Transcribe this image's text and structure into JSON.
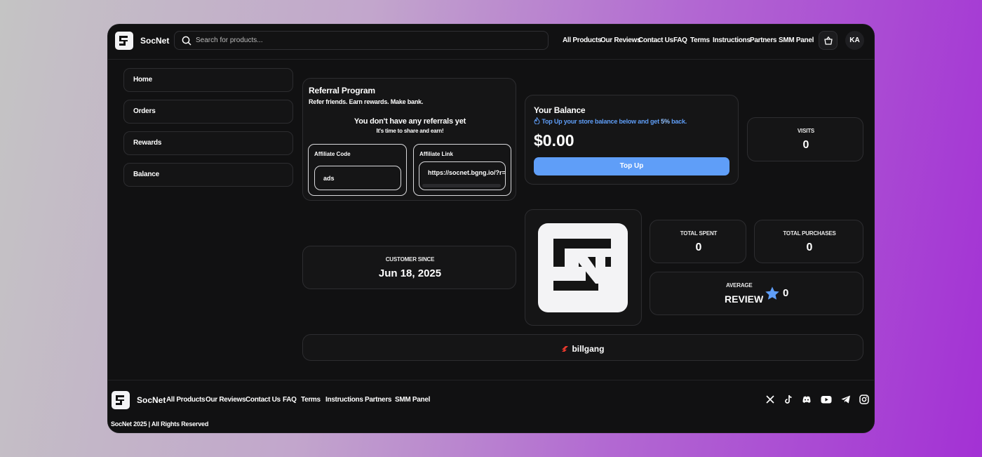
{
  "header": {
    "brand": "SocNet",
    "search_placeholder": "Search for products...",
    "nav": [
      "All Products",
      "Our Reviews",
      "Contact Us",
      "FAQ",
      "Terms",
      "Instructions",
      "Partners",
      "SMM Panel"
    ],
    "avatar_initials": "KA"
  },
  "sidebar": {
    "items": [
      {
        "label": "Home"
      },
      {
        "label": "Orders"
      },
      {
        "label": "Rewards"
      },
      {
        "label": "Balance"
      }
    ]
  },
  "referral": {
    "title": "Referral Program",
    "subtitle": "Refer friends. Earn rewards. Make bank.",
    "empty_title": "You don't have any referrals yet",
    "empty_subtitle": "It's time to share and earn!",
    "affiliate_code_label": "Affiliate Code",
    "affiliate_code_value": "ads",
    "affiliate_link_label": "Affiliate Link",
    "affiliate_link_value": "https://socnet.bgng.io/?r=ads"
  },
  "balance": {
    "title": "Your Balance",
    "note_prefix": "Top Up your store balance below and get ",
    "note_percent": "5%",
    "note_suffix": " back.",
    "amount": "$0.00",
    "button": "Top Up"
  },
  "stats": {
    "visits_label": "VISITS",
    "visits_value": "0",
    "customer_since_label": "CUSTOMER SINCE",
    "customer_since_value": "Jun 18, 2025",
    "total_spent_label": "TOTAL SPENT",
    "total_spent_value": "0",
    "total_purchases_label": "TOTAL PURCHASES",
    "total_purchases_value": "0",
    "average_label": "AVERAGE",
    "review_label": "REVIEW",
    "review_value": "0"
  },
  "powered_by": "billgang",
  "footer": {
    "brand": "SocNet",
    "nav": [
      "All Products",
      "Our Reviews",
      "Contact Us",
      "FAQ",
      "Terms",
      "Instructions",
      "Partners",
      "SMM Panel"
    ],
    "copyright": "SocNet 2025 | All Rights Reserved",
    "socials": [
      "x-icon",
      "tiktok-icon",
      "discord-icon",
      "youtube-icon",
      "telegram-icon",
      "instagram-icon"
    ]
  },
  "colors": {
    "accent": "#5f9ef8",
    "background": "#111112",
    "card": "#151516",
    "billgang_red": "#e8392c"
  }
}
